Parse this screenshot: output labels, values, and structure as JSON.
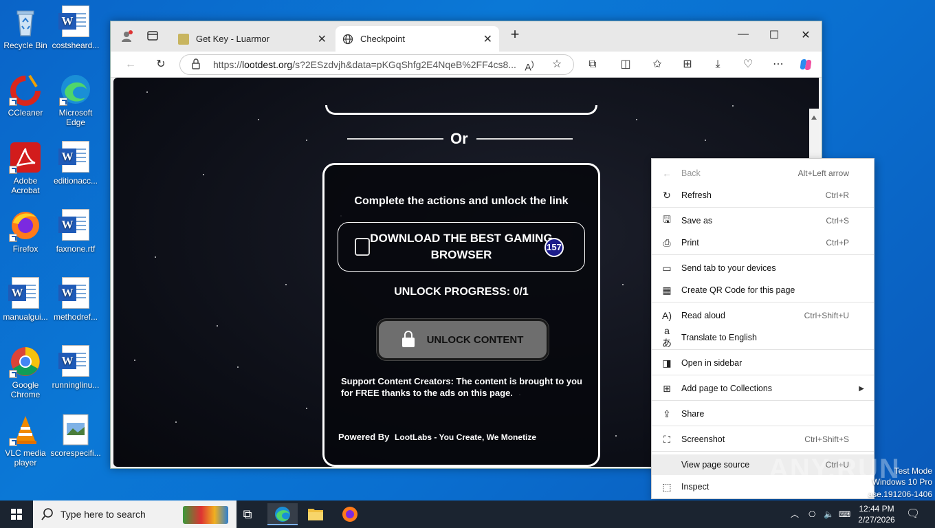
{
  "desktop": {
    "icons": [
      {
        "label": "Recycle Bin"
      },
      {
        "label": "costsheard..."
      },
      {
        "label": "CCleaner"
      },
      {
        "label": "Microsoft Edge"
      },
      {
        "label": "Adobe Acrobat"
      },
      {
        "label": "editionacc..."
      },
      {
        "label": "Firefox"
      },
      {
        "label": "faxnone.rtf"
      },
      {
        "label": "manualgui..."
      },
      {
        "label": "methodref..."
      },
      {
        "label": "Google Chrome"
      },
      {
        "label": "runninglinu..."
      },
      {
        "label": "VLC media player"
      },
      {
        "label": "scorespecifi..."
      }
    ]
  },
  "browser": {
    "tabs": [
      {
        "title": "Get Key - Luarmor",
        "close": "✕"
      },
      {
        "title": "Checkpoint",
        "close": "✕"
      }
    ],
    "new_tab": "+",
    "window": {
      "minimize": "—",
      "maximize": "☐",
      "close": "✕"
    },
    "url": {
      "prefix": "https://",
      "domain": "lootdest.org",
      "rest": "/s?2ESzdvjh&data=pKGqShfg2E4NqeB%2FF4cs8..."
    }
  },
  "page": {
    "or_text": "Or",
    "card_title": "Complete the actions and unlock the link",
    "task_label": "DOWNLOAD THE BEST GAMING BROWSER",
    "task_badge": "157",
    "progress": "UNLOCK PROGRESS: 0/1",
    "unlock_button": "UNLOCK CONTENT",
    "support": "Support Content Creators: The content is brought to you for FREE thanks to the ads on this page.",
    "powered_by": "Powered By",
    "brand": "LootLabs - You Create, We Monetize"
  },
  "context_menu": {
    "items": [
      {
        "label": "Back",
        "shortcut": "Alt+Left arrow",
        "icon": "back-arrow-icon"
      },
      {
        "label": "Refresh",
        "shortcut": "Ctrl+R",
        "icon": "refresh-icon"
      },
      {
        "label": "Save as",
        "shortcut": "Ctrl+S",
        "icon": "save-icon"
      },
      {
        "label": "Print",
        "shortcut": "Ctrl+P",
        "icon": "print-icon"
      },
      {
        "label": "Send tab to your devices",
        "shortcut": "",
        "icon": "send-tab-icon"
      },
      {
        "label": "Create QR Code for this page",
        "shortcut": "",
        "icon": "qr-code-icon"
      },
      {
        "label": "Read aloud",
        "shortcut": "Ctrl+Shift+U",
        "icon": "read-aloud-icon"
      },
      {
        "label": "Translate to English",
        "shortcut": "",
        "icon": "translate-icon"
      },
      {
        "label": "Open in sidebar",
        "shortcut": "",
        "icon": "sidebar-icon"
      },
      {
        "label": "Add page to Collections",
        "shortcut": "",
        "icon": "collections-icon"
      },
      {
        "label": "Share",
        "shortcut": "",
        "icon": "share-icon"
      },
      {
        "label": "Screenshot",
        "shortcut": "Ctrl+Shift+S",
        "icon": "screenshot-icon"
      },
      {
        "label": "View page source",
        "shortcut": "Ctrl+U",
        "icon": ""
      },
      {
        "label": "Inspect",
        "shortcut": "",
        "icon": "inspect-icon"
      }
    ]
  },
  "watermark": {
    "text": "ANY.RUN",
    "line1": "Test Mode",
    "line2": "Windows 10 Pro",
    "line3": "ase.191206-1406"
  },
  "taskbar": {
    "search_placeholder": "Type here to search",
    "time": "12:44 PM",
    "date": "2/27/2026"
  }
}
